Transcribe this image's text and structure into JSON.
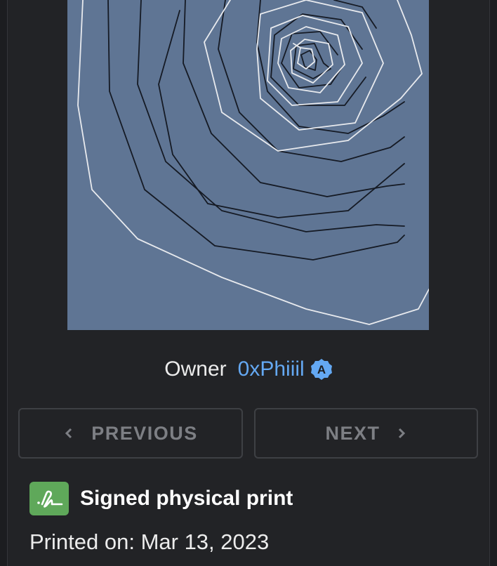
{
  "artwork": {
    "background_color": "#5f7594",
    "line_colors": [
      "#151a24",
      "#e8eaee"
    ]
  },
  "owner": {
    "label": "Owner",
    "name": "0xPhiiil",
    "badge_letter": "A",
    "name_color": "#64a8f2"
  },
  "navigation": {
    "previous_label": "PREVIOUS",
    "next_label": "NEXT"
  },
  "print_info": {
    "title": "Signed physical print",
    "printed_label": "Printed on:",
    "printed_date": "Mar 13, 2023",
    "icon_color": "#5fa85a"
  }
}
